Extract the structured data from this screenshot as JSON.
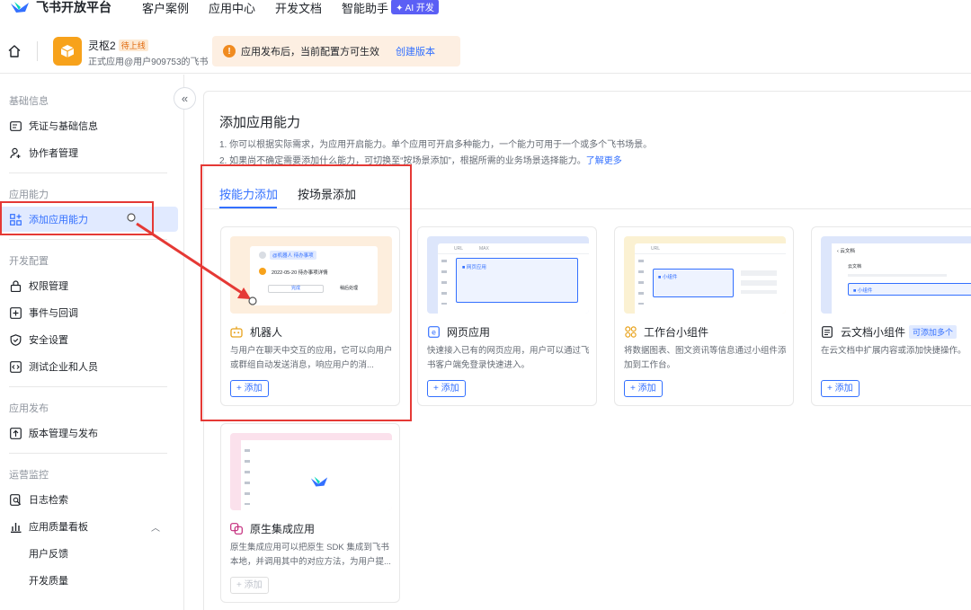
{
  "topnav": {
    "logo_text": "飞书开放平台",
    "items": [
      "客户案例",
      "应用中心",
      "开发文档",
      "智能助手"
    ],
    "ai_badge": "AI 开发"
  },
  "app": {
    "name": "灵枢2",
    "status": "待上线",
    "subtitle": "正式应用@用户909753的飞书",
    "notice": "应用发布后，当前配置方可生效",
    "notice_link": "创建版本"
  },
  "sidebar": {
    "sections": [
      {
        "title": "基础信息",
        "items": [
          "凭证与基础信息",
          "协作者管理"
        ]
      },
      {
        "title": "应用能力",
        "items": [
          "添加应用能力"
        ]
      },
      {
        "title": "开发配置",
        "items": [
          "权限管理",
          "事件与回调",
          "安全设置",
          "测试企业和人员"
        ]
      },
      {
        "title": "应用发布",
        "items": [
          "版本管理与发布"
        ]
      },
      {
        "title": "运营监控",
        "items": [
          "日志检索",
          "应用质量看板",
          "用户反馈",
          "开发质量"
        ]
      }
    ]
  },
  "main": {
    "title": "添加应用能力",
    "desc1": "1. 你可以根据实际需求，为应用开启能力。单个应用可开启多种能力，一个能力可用于一个或多个飞书场景。",
    "desc2": "2. 如果尚不确定需要添加什么能力，可切换至“按场景添加”，根据所需的业务场景选择能力。",
    "desc2_link": "了解更多",
    "tabs": [
      "按能力添加",
      "按场景添加"
    ],
    "add_label": "+ 添加"
  },
  "cards": [
    {
      "title": "机器人",
      "desc": "与用户在聊天中交互的应用，它可以向用户或群组自动发送消息，响应用户的消..."
    },
    {
      "title": "网页应用",
      "desc": "快速接入已有的网页应用，用户可以通过飞书客户端免登录快速进入。"
    },
    {
      "title": "工作台小组件",
      "desc": "将数据图表、图文资讯等信息通过小组件添加到工作台。"
    },
    {
      "title": "云文档小组件",
      "badge": "可添加多个",
      "desc": "在云文档中扩展内容或添加快捷操作。"
    },
    {
      "title": "原生集成应用",
      "desc": "原生集成应用可以把原生 SDK 集成到飞书本地，并调用其中的对应方法，为用户提..."
    }
  ],
  "thumbs": {
    "bot_chip1": "@机器人",
    "bot_chip2": "待办事项",
    "bot_line": "2022-05-20 待办事项详情",
    "bot_btn1": "完成",
    "bot_btn2": "稍后处理",
    "web_url": "URL",
    "web_url2": "MAX",
    "web_panel": "网页应用",
    "wb_tab": "URL",
    "wb_widget": "小组件",
    "doc_header": "云文档",
    "doc_sub": "云文档",
    "doc_widget": "小组件"
  },
  "colors": {
    "accent": "#3370ff",
    "annotation_red": "#e53935",
    "active_bg": "#e1eaff"
  }
}
